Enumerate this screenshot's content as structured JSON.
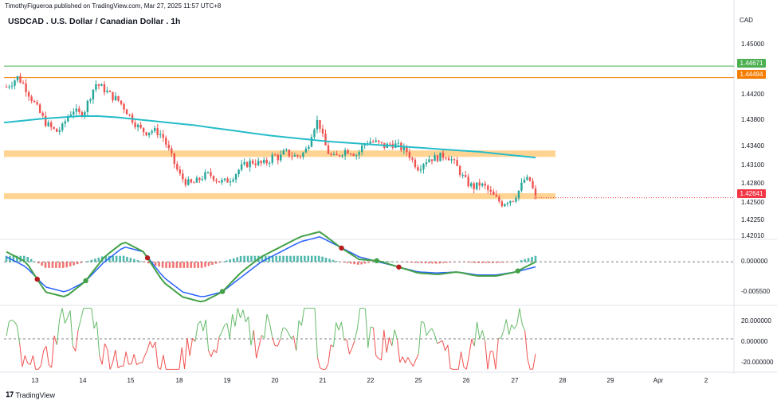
{
  "header": {
    "publisher": "TimothyFigueroa published on TradingView.com, Mar 27, 2025 11:57 UTC+8",
    "title": "USDCAD . U.S. Dollar / Canadian Dollar . 1h",
    "currency": "CAD"
  },
  "colors": {
    "up": "#26a69a",
    "down": "#ef5350",
    "ma": "#26bcc9",
    "zone": "#ffcc80",
    "green_line": "#4caf50",
    "orange_line": "#f57c00",
    "last_price": "#f23645"
  },
  "price_axis": {
    "ticks": [
      "1.45000",
      "1.44200",
      "1.43800",
      "1.43400",
      "1.43100",
      "1.42800",
      "1.42500",
      "1.42250",
      "1.42010"
    ],
    "tags": {
      "green": "1.44671",
      "orange": "1.44494",
      "last": "1.42641"
    }
  },
  "macd_axis": {
    "ticks": [
      "0.000000",
      "-0.005500"
    ]
  },
  "osc_axis": {
    "ticks": [
      "20.000000",
      "0.000000",
      "-20.000000"
    ]
  },
  "time_axis": {
    "ticks": [
      "13",
      "14",
      "15",
      "18",
      "19",
      "20",
      "21",
      "22",
      "25",
      "26",
      "27",
      "28",
      "29",
      "Apr",
      "2"
    ]
  },
  "footer": {
    "logo_text": "TradingView",
    "logo_icon": "tradingview-logo-icon"
  },
  "chart_data": {
    "type": "candlestick",
    "title": "USDCAD . U.S. Dollar / Canadian Dollar . 1h",
    "ylim": [
      1.4201,
      1.4525
    ],
    "levels": {
      "resistance_green": 1.44671,
      "resistance_orange": 1.44494,
      "last_price": 1.42641
    },
    "zones": [
      {
        "from": 1.4327,
        "to": 1.4337
      },
      {
        "from": 1.4262,
        "to": 1.4271
      }
    ],
    "close_path": [
      1.4435,
      1.4442,
      1.445,
      1.444,
      1.4425,
      1.441,
      1.4395,
      1.438,
      1.4372,
      1.4366,
      1.4372,
      1.439,
      1.44,
      1.4393,
      1.4398,
      1.442,
      1.444,
      1.4435,
      1.4428,
      1.442,
      1.4415,
      1.4405,
      1.4392,
      1.438,
      1.437,
      1.4365,
      1.4368,
      1.4366,
      1.436,
      1.434,
      1.432,
      1.43,
      1.429,
      1.4285,
      1.4288,
      1.4295,
      1.43,
      1.4298,
      1.429,
      1.4288,
      1.4292,
      1.43,
      1.431,
      1.4315,
      1.432,
      1.4318,
      1.4316,
      1.432,
      1.433,
      1.4325,
      1.4335,
      1.433,
      1.4328,
      1.433,
      1.434,
      1.437,
      1.4385,
      1.435,
      1.433,
      1.4325,
      1.4333,
      1.4338,
      1.4335,
      1.433,
      1.4345,
      1.4352,
      1.435,
      1.4347,
      1.4343,
      1.4348,
      1.4345,
      1.434,
      1.4335,
      1.432,
      1.431,
      1.432,
      1.4325,
      1.4325,
      1.4328,
      1.433,
      1.4322,
      1.431,
      1.4295,
      1.4285,
      1.428,
      1.4285,
      1.428,
      1.427,
      1.4262,
      1.4255,
      1.426,
      1.4262,
      1.4275,
      1.4292,
      1.429,
      1.4264
    ],
    "ma_path": [
      1.438,
      1.4383,
      1.4386,
      1.4388,
      1.439,
      1.439,
      1.4388,
      1.4385,
      1.4382,
      1.4379,
      1.4376,
      1.4372,
      1.4368,
      1.4364,
      1.436,
      1.4357,
      1.4354,
      1.4351,
      1.4349,
      1.4347,
      1.4345,
      1.4343,
      1.4341,
      1.4339,
      1.4337,
      1.4335,
      1.4332,
      1.4329,
      1.4326
    ],
    "macd_series": [
      {
        "name": "macd",
        "values": [
          0.002,
          0.0,
          -0.006,
          -0.007,
          -0.004,
          0.001,
          0.004,
          0.002,
          -0.004,
          -0.007,
          -0.008,
          -0.006,
          -0.002,
          0.001,
          0.003,
          0.005,
          0.006,
          0.003,
          0.0005,
          0.0002,
          -0.001,
          -0.0022,
          -0.0025,
          -0.002,
          -0.0028,
          -0.0028,
          -0.002,
          0.0
        ]
      },
      {
        "name": "signal",
        "values": [
          0.001,
          -0.001,
          -0.005,
          -0.006,
          -0.004,
          0.0,
          0.003,
          0.002,
          -0.003,
          -0.006,
          -0.007,
          -0.006,
          -0.003,
          0.0,
          0.002,
          0.004,
          0.005,
          0.003,
          0.001,
          0.0,
          -0.001,
          -0.002,
          -0.0022,
          -0.002,
          -0.0026,
          -0.0026,
          -0.002,
          -0.001
        ]
      }
    ],
    "macd_ylim": [
      -0.0085,
      0.004
    ],
    "osc_ylim": [
      -25,
      25
    ]
  }
}
